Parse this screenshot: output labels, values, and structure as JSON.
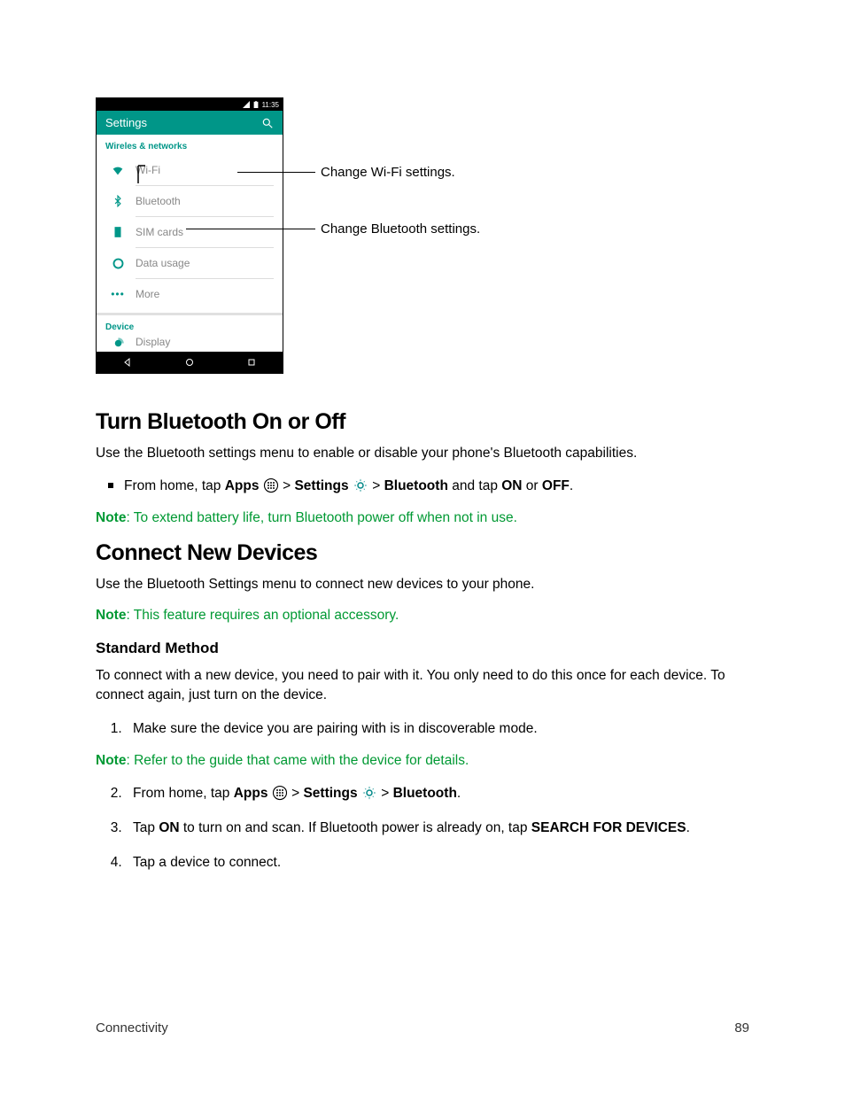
{
  "phone": {
    "status_time": "11:35",
    "appbar_title": "Settings",
    "section1": "Wireles & networks",
    "rows1": {
      "wifi": "Wi-Fi",
      "bluetooth": "Bluetooth",
      "sim": "SIM cards",
      "data": "Data usage",
      "more": "More"
    },
    "section2": "Device",
    "rows2": {
      "display": "Display"
    }
  },
  "callouts": {
    "wifi": "Change Wi-Fi settings.",
    "bt": "Change Bluetooth settings."
  },
  "sec1": {
    "h": "Turn Bluetooth On or Off",
    "p": "Use the Bluetooth settings menu to enable or disable your phone's Bluetooth capabilities.",
    "bullet": {
      "pre": "From home, tap ",
      "apps": "Apps",
      "sep1": " > ",
      "settings": "Settings",
      "sep2": " > ",
      "bt": "Bluetooth",
      "mid": " and tap ",
      "on": "ON",
      "or": " or ",
      "off": "OFF",
      "end": "."
    },
    "note_b": "Note",
    "note": ": To extend battery life, turn Bluetooth power off when not in use."
  },
  "sec2": {
    "h": "Connect New Devices",
    "p": "Use the Bluetooth Settings menu to connect new devices to your phone.",
    "note_b": "Note",
    "note": ": This feature requires an optional accessory.",
    "h3": "Standard Method",
    "p2": "To connect with a new device, you need to pair with it. You only need to do this once for each device. To connect again, just turn on the device.",
    "li1": "Make sure the device you are pairing with is in discoverable mode.",
    "note2_b": "Note",
    "note2": ": Refer to the guide that came with the device for details.",
    "li2": {
      "pre": "From home, tap ",
      "apps": "Apps",
      "sep1": " > ",
      "settings": "Settings",
      "sep2": " > ",
      "bt": "Bluetooth",
      "end": "."
    },
    "li3": {
      "a": "Tap ",
      "on": "ON",
      "b": " to turn on and scan. If Bluetooth power is already on, tap ",
      "search": "SEARCH FOR DEVICES",
      "c": "."
    },
    "li4": "Tap a device to connect."
  },
  "footer": {
    "left": "Connectivity",
    "right": "89"
  }
}
